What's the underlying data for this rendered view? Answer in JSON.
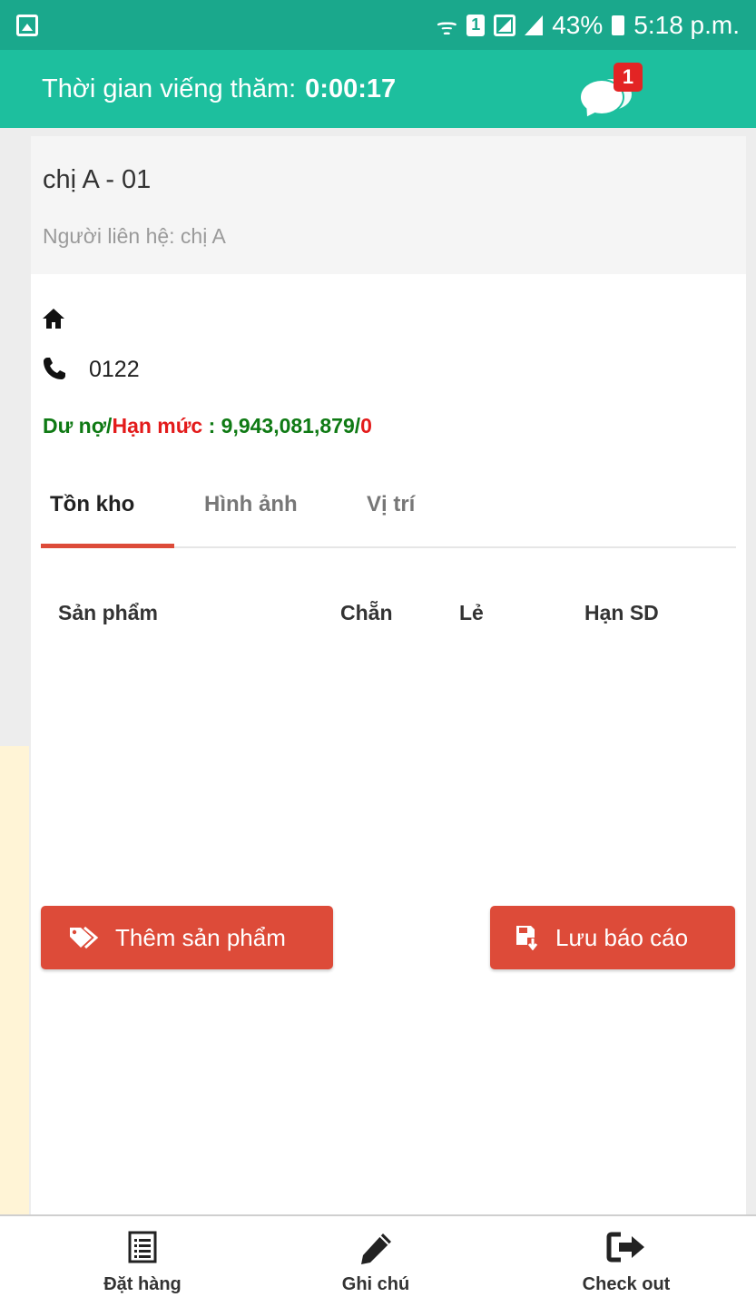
{
  "status_bar": {
    "battery": "43%",
    "time": "5:18 p.m.",
    "sim": "1"
  },
  "header": {
    "visit_label": "Thời gian viếng thăm:",
    "visit_time": "0:00:17",
    "chat_count": "1"
  },
  "customer": {
    "name": "chị A - 01",
    "contact": "Người liên hệ: chị A",
    "phone": "0122",
    "debt_label": "Dư nợ/",
    "limit_label": "Hạn mức",
    "separator": " : ",
    "debt_value": "9,943,081,879/",
    "limit_value": "0"
  },
  "tabs": [
    {
      "label": "Tồn kho",
      "active": true
    },
    {
      "label": "Hình ảnh",
      "active": false
    },
    {
      "label": "Vị trí",
      "active": false
    }
  ],
  "table": {
    "columns": [
      "Sản phẩm",
      "Chẵn",
      "Lẻ",
      "Hạn SD"
    ]
  },
  "actions": {
    "add_product": "Thêm sản phẩm",
    "save_report": "Lưu báo cáo"
  },
  "bottom_nav": [
    {
      "label": "Đặt hàng",
      "icon": "list-icon"
    },
    {
      "label": "Ghi chú",
      "icon": "pencil-icon"
    },
    {
      "label": "Check out",
      "icon": "exit-icon"
    }
  ],
  "colors": {
    "status_bar": "#1aa88c",
    "header": "#1dbf9e",
    "accent": "#dd4b39",
    "debt_green": "#0f7a14",
    "limit_red": "#e31b1b",
    "badge": "#e32424"
  }
}
